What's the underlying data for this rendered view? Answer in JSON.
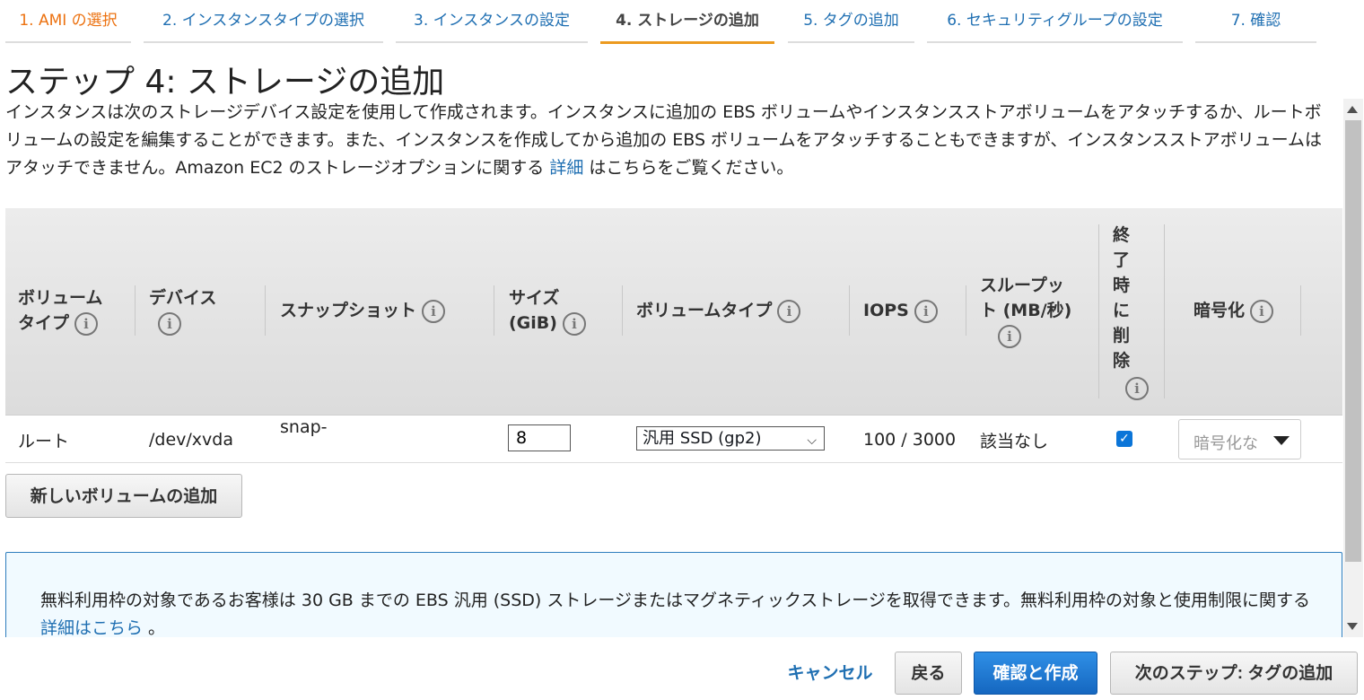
{
  "steps": [
    {
      "label": "1. AMI の選択"
    },
    {
      "label": "2. インスタンスタイプの選択"
    },
    {
      "label": "3. インスタンスの設定"
    },
    {
      "label": "4. ストレージの追加"
    },
    {
      "label": "5. タグの追加"
    },
    {
      "label": "6. セキュリティグループの設定"
    },
    {
      "label": "7. 確認"
    }
  ],
  "active_step": 4,
  "page": {
    "title": "ステップ 4: ストレージの追加",
    "description_before_link": "インスタンスは次のストレージデバイス設定を使用して作成されます。インスタンスに追加の EBS ボリュームやインスタンスストアボリュームをアタッチするか、ルートボリュームの設定を編集することができます。また、インスタンスを作成してから追加の EBS ボリュームをアタッチすることもできますが、インスタンスストアボリュームはアタッチできません。Amazon EC2 のストレージオプションに関する ",
    "description_link": "詳細",
    "description_after_link": " はこちらをご覧ください。"
  },
  "table": {
    "headers": {
      "volume_type_l1": "ボリューム",
      "volume_type_l2": "タイプ",
      "device": "デバイス",
      "snapshot": "スナップショット",
      "size_l1": "サイズ",
      "size_l2": "(GiB)",
      "ebs_type": "ボリュームタイプ",
      "iops": "IOPS",
      "throughput_l1": "スループッ",
      "throughput_l2": "ト (MB/秒)",
      "delete_on_term": [
        "終",
        "了",
        "時",
        "に",
        "削",
        "除"
      ],
      "encryption": "暗号化"
    },
    "info_glyph": "i",
    "rows": [
      {
        "volume_type": "ルート",
        "device": "/dev/xvda",
        "snapshot": "snap-",
        "size": "8",
        "ebs_type": "汎用 SSD (gp2)",
        "iops": "100 / 3000",
        "throughput": "該当なし",
        "delete_on_termination": true,
        "encryption_placeholder": "暗号化な"
      }
    ]
  },
  "icons": {
    "info": "info-circle-icon",
    "chevron": "chevron-down-icon",
    "caret": "caret-down-icon",
    "check": "checkmark-icon"
  },
  "buttons": {
    "add_volume": "新しいボリュームの追加",
    "cancel": "キャンセル",
    "back": "戻る",
    "review_launch": "確認と作成",
    "next": "次のステップ: タグの追加"
  },
  "notice": {
    "text_before_link": "無料利用枠の対象であるお客様は 30 GB までの EBS 汎用 (SSD) ストレージまたはマグネティックストレージを取得できます。無料利用枠の対象と使用制限に関する ",
    "link": "詳細はこちら",
    "text_after_link": " 。"
  },
  "colors": {
    "done_step": "#ec7211",
    "link": "#1f6fb2",
    "active_underline": "#ec9a1f",
    "primary_button": "#1567c0",
    "notice_border": "#2d7dbd"
  }
}
